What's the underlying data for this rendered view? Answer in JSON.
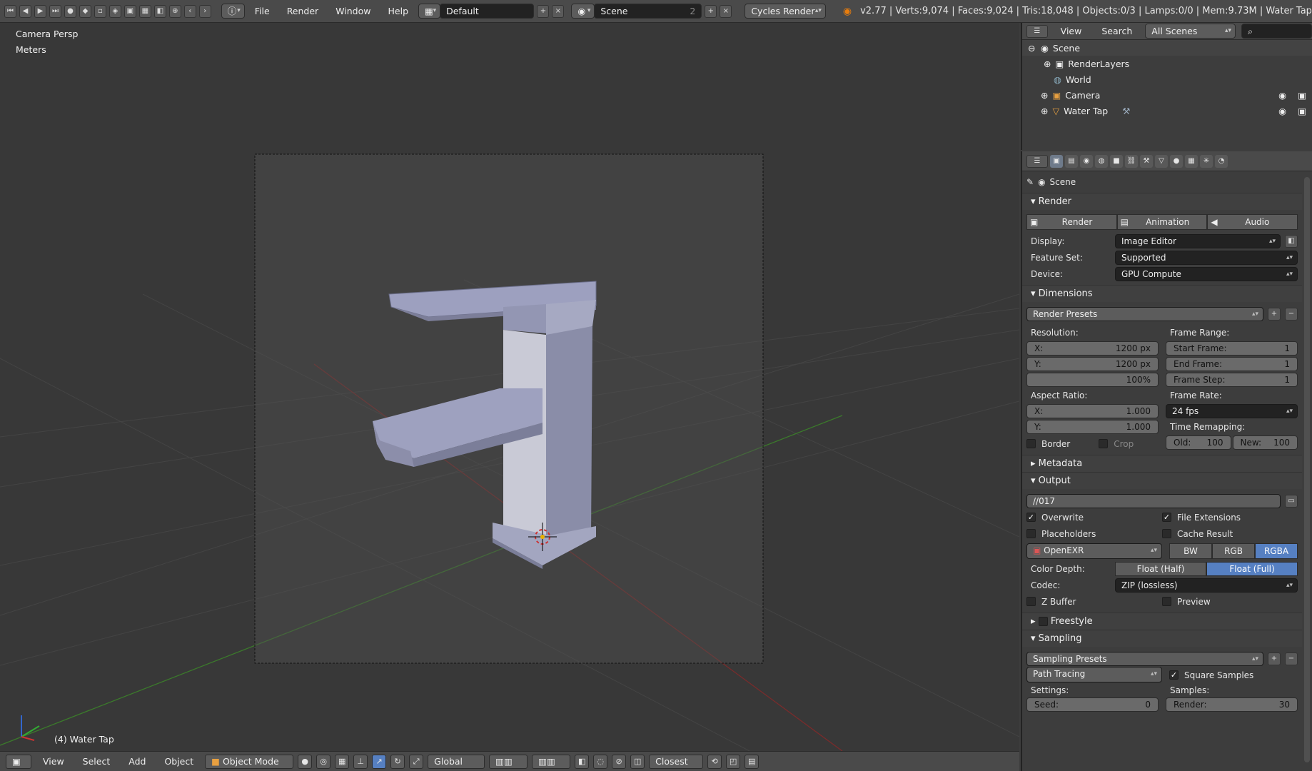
{
  "topbar": {
    "menus": [
      "File",
      "Render",
      "Window",
      "Help"
    ],
    "layout": "Default",
    "scene": "Scene",
    "scene_users": "2",
    "engine": "Cycles Render",
    "stats": "v2.77 | Verts:9,074 | Faces:9,024 | Tris:18,048 | Objects:0/3 | Lamps:0/0 | Mem:9.73M | Water Tap"
  },
  "viewport": {
    "view_name": "Camera Persp",
    "units": "Meters",
    "object_info": "(4) Water Tap"
  },
  "bottombar": {
    "menus": [
      "View",
      "Select",
      "Add",
      "Object"
    ],
    "mode": "Object Mode",
    "orientation": "Global",
    "snap": "Closest"
  },
  "outliner": {
    "view": "View",
    "search": "Search",
    "filter": "All Scenes",
    "items": [
      {
        "label": "Scene"
      },
      {
        "label": "RenderLayers"
      },
      {
        "label": "World"
      },
      {
        "label": "Camera"
      },
      {
        "label": "Water Tap"
      }
    ]
  },
  "properties": {
    "context": "Scene",
    "render": {
      "title": "Render",
      "buttons": [
        "Render",
        "Animation",
        "Audio"
      ],
      "display_label": "Display:",
      "display": "Image Editor",
      "feature_label": "Feature Set:",
      "feature": "Supported",
      "device_label": "Device:",
      "device": "GPU Compute"
    },
    "dimensions": {
      "title": "Dimensions",
      "presets": "Render Presets",
      "resolution_label": "Resolution:",
      "res_x_k": "X:",
      "res_x": "1200 px",
      "res_y_k": "Y:",
      "res_y": "1200 px",
      "res_pct": "100%",
      "frame_range_label": "Frame Range:",
      "start_k": "Start Frame:",
      "start": "1",
      "end_k": "End Frame:",
      "end": "1",
      "step_k": "Frame Step:",
      "step": "1",
      "aspect_label": "Aspect Ratio:",
      "asp_x_k": "X:",
      "asp_x": "1.000",
      "asp_y_k": "Y:",
      "asp_y": "1.000",
      "frame_rate_label": "Frame Rate:",
      "frame_rate": "24 fps",
      "time_remap_label": "Time Remapping:",
      "old_k": "Old:",
      "old": "100",
      "new_k": "New:",
      "new": "100",
      "border": "Border",
      "crop": "Crop"
    },
    "metadata": {
      "title": "Metadata"
    },
    "output": {
      "title": "Output",
      "path": "//017",
      "overwrite": "Overwrite",
      "file_ext": "File Extensions",
      "placeholders": "Placeholders",
      "cache": "Cache Result",
      "format": "OpenEXR",
      "color_modes": [
        "BW",
        "RGB",
        "RGBA"
      ],
      "color_depth_label": "Color Depth:",
      "depths": [
        "Float (Half)",
        "Float (Full)"
      ],
      "codec_label": "Codec:",
      "codec": "ZIP (lossless)",
      "zbuffer": "Z Buffer",
      "preview": "Preview"
    },
    "freestyle": {
      "title": "Freestyle"
    },
    "sampling": {
      "title": "Sampling",
      "presets": "Sampling Presets",
      "integrator": "Path Tracing",
      "square": "Square Samples",
      "settings_label": "Settings:",
      "samples_label": "Samples:",
      "seed_k": "Seed:",
      "seed": "0",
      "render_k": "Render:",
      "render": "30"
    }
  }
}
